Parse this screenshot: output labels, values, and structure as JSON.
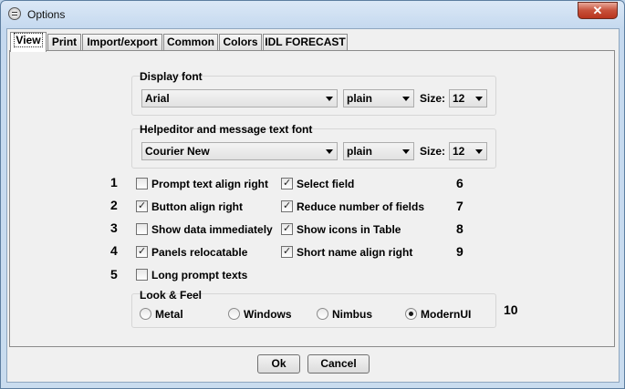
{
  "window": {
    "title": "Options",
    "close_label": "✕"
  },
  "tabs": [
    {
      "label": "View"
    },
    {
      "label": "Print"
    },
    {
      "label": "Import/export"
    },
    {
      "label": "Common"
    },
    {
      "label": "Colors"
    },
    {
      "label": "IDL FORECAST"
    }
  ],
  "display_font": {
    "label": "Display font",
    "font": "Arial",
    "style": "plain",
    "size_label": "Size:",
    "size": "12"
  },
  "help_font": {
    "label": "Helpeditor and message text font",
    "font": "Courier New",
    "style": "plain",
    "size_label": "Size:",
    "size": "12"
  },
  "options_left": [
    {
      "num": "1",
      "label": "Prompt text align right",
      "checked": false
    },
    {
      "num": "2",
      "label": "Button align right",
      "checked": true
    },
    {
      "num": "3",
      "label": "Show data immediately",
      "checked": false
    },
    {
      "num": "4",
      "label": "Panels relocatable",
      "checked": true
    },
    {
      "num": "5",
      "label": "Long prompt texts",
      "checked": false
    }
  ],
  "options_right": [
    {
      "num": "6",
      "label": "Select field",
      "checked": true
    },
    {
      "num": "7",
      "label": "Reduce number of fields",
      "checked": true
    },
    {
      "num": "8",
      "label": "Show icons in Table",
      "checked": true
    },
    {
      "num": "9",
      "label": "Short name align right",
      "checked": true
    }
  ],
  "look_feel": {
    "label": "Look & Feel",
    "num": "10",
    "options": [
      {
        "label": "Metal",
        "selected": false
      },
      {
        "label": "Windows",
        "selected": false
      },
      {
        "label": "Nimbus",
        "selected": false
      },
      {
        "label": "ModernUI",
        "selected": true
      }
    ]
  },
  "buttons": {
    "ok": "Ok",
    "cancel": "Cancel"
  },
  "icons": {
    "app": "options-app-icon",
    "close": "close-icon",
    "dropdown": "chevron-down-icon"
  }
}
